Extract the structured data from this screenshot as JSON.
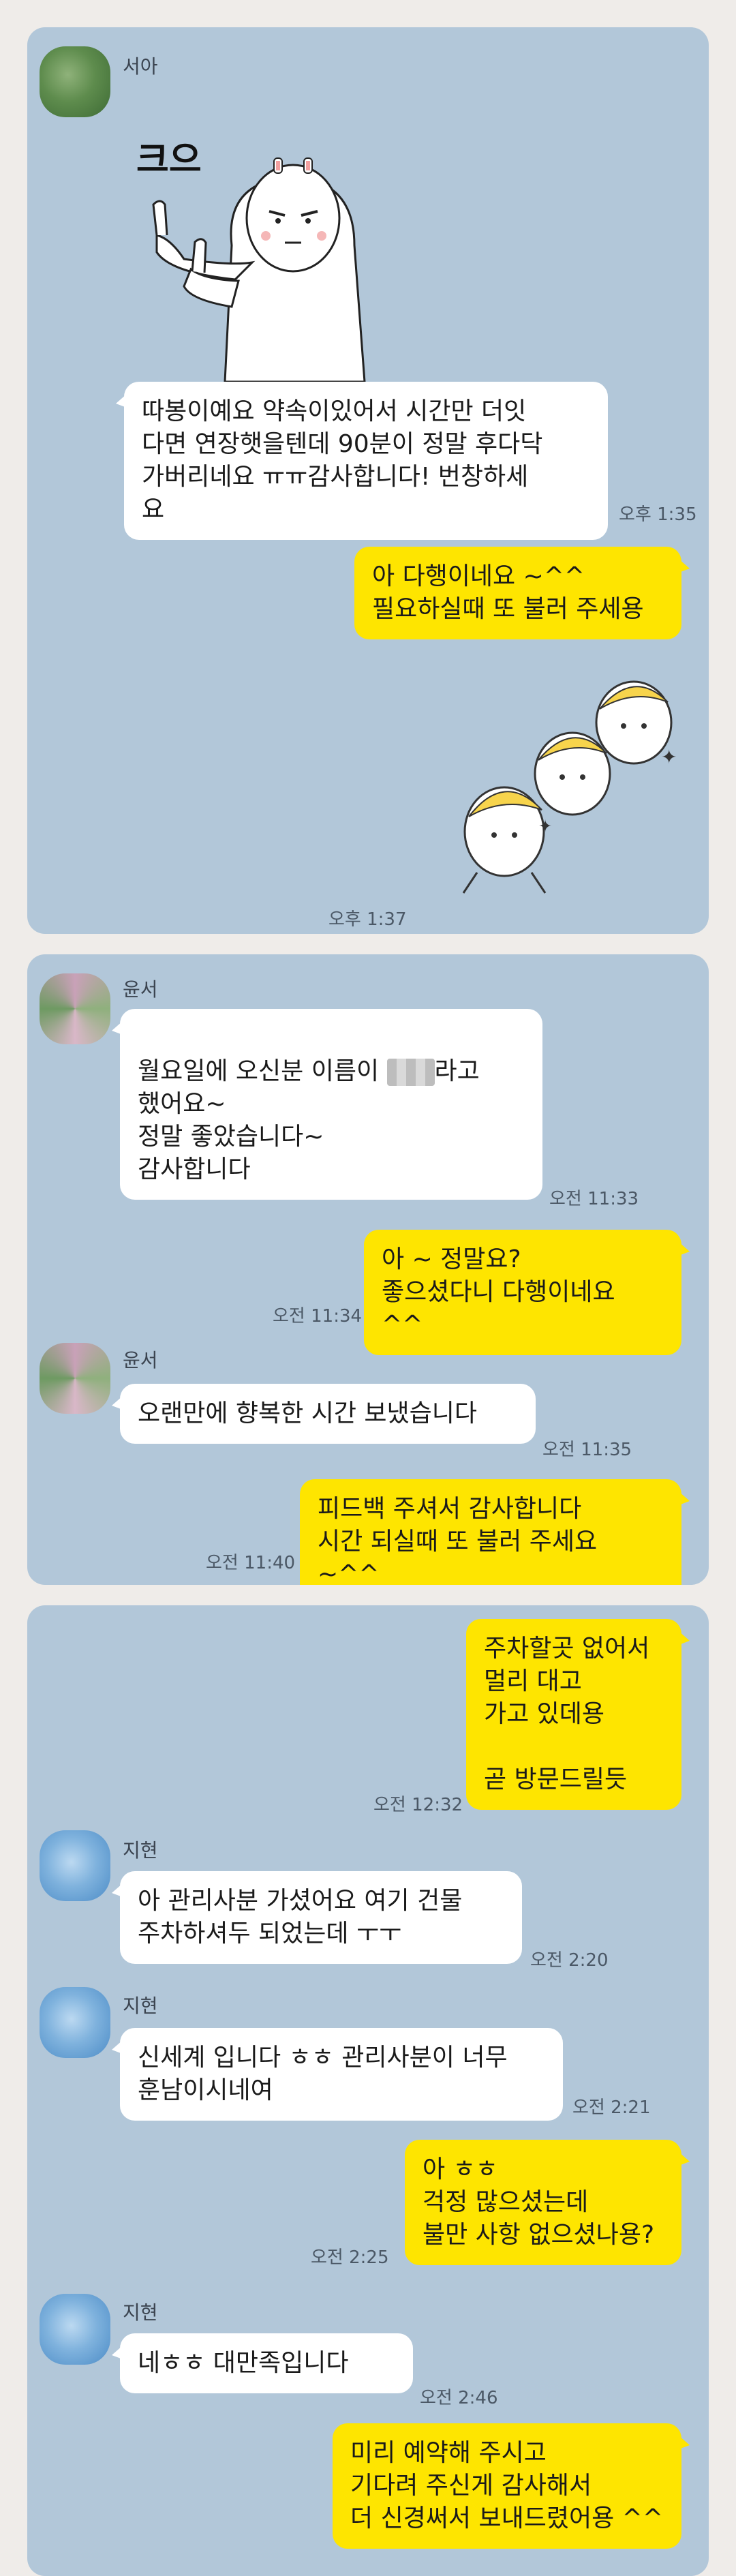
{
  "panel1": {
    "name": "서아",
    "sticker1_text": "크으",
    "msg1": "따봉이예요 약속이있어서 시간만 더잇\n다면 연장햇을텐데 90분이 정말 후다닥\n가버리네요 ㅠㅠ감사합니다! 번창하세\n요",
    "time1": "오후 1:35",
    "msg2": "아 다행이네요 ~^^\n필요하실때 또 불러 주세용",
    "time2": "오후 1:37"
  },
  "panel2": {
    "name1": "윤서",
    "msg1_a": "월요일에 오신분 이름이 ",
    "msg1_b": "라고\n했어요~\n정말 좋았습니다~\n감사합니다",
    "time1": "오전 11:33",
    "msg2": "아 ~ 정말요?\n좋으셨다니 다행이네요 ^^",
    "time2": "오전 11:34",
    "name2": "윤서",
    "msg3": "오랜만에 향복한 시간 보냈습니다",
    "time3": "오전 11:35",
    "msg4": "피드백 주셔서 감사합니다\n시간 되실때 또 불러 주세요 ~^^",
    "time4": "오전 11:40"
  },
  "panel3": {
    "msg1": "주차할곳 없어서\n멀리 대고\n가고 있데용\n\n곧 방문드릴듯",
    "time1": "오전 12:32",
    "name1": "지현",
    "msg2": "아 관리사분 가셨어요 여기 건물\n주차하셔두 되었는데 ㅜㅜ",
    "time2": "오전 2:20",
    "name2": "지현",
    "msg3": "신세계 입니다 ㅎㅎ 관리사분이 너무\n훈남이시네여",
    "time3": "오전 2:21",
    "msg4": "아 ㅎㅎ\n걱정 많으셨는데\n불만 사항 없으셨나용?",
    "time4": "오전 2:25",
    "name3": "지현",
    "msg5": "네ㅎㅎ 대만족입니다",
    "time5": "오전 2:46",
    "msg6": "미리 예약해 주시고\n기다려 주신게 감사해서\n더 신경써서 보내드렸어용 ^^"
  },
  "colors": {
    "chat_bg": "#b2c7d9",
    "my_bubble": "#fee500",
    "their_bubble": "#ffffff",
    "page_bg": "#efece9"
  }
}
